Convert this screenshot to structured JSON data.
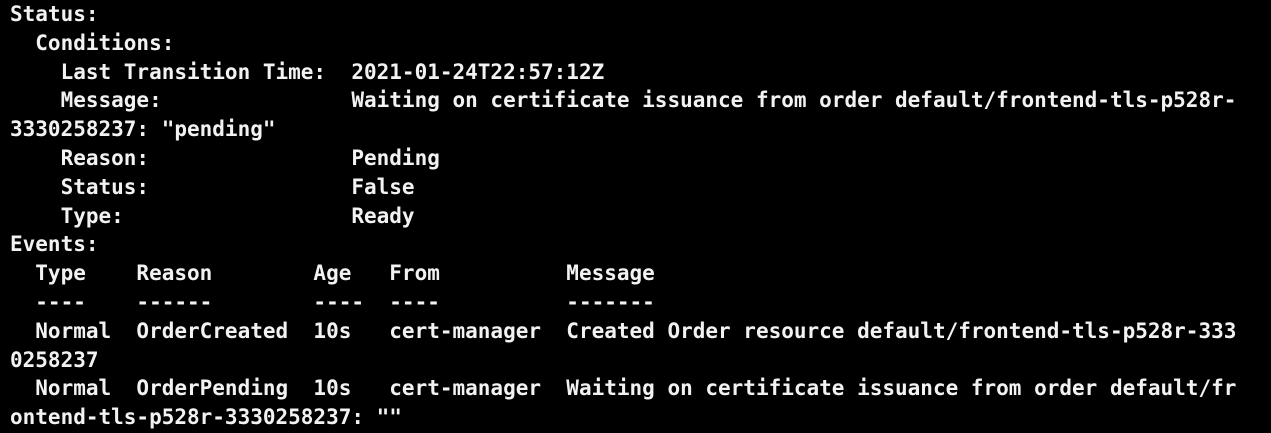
{
  "terminal": {
    "lines": [
      "Status:",
      "  Conditions:",
      "    Last Transition Time:  2021-01-24T22:57:12Z",
      "    Message:               Waiting on certificate issuance from order default/frontend-tls-p528r-",
      "3330258237: \"pending\"",
      "    Reason:                Pending",
      "    Status:                False",
      "    Type:                  Ready",
      "Events:",
      "  Type    Reason        Age   From          Message",
      "  ----    ------        ----  ----          -------",
      "  Normal  OrderCreated  10s   cert-manager  Created Order resource default/frontend-tls-p528r-333",
      "0258237",
      "  Normal  OrderPending  10s   cert-manager  Waiting on certificate issuance from order default/fr",
      "ontend-tls-p528r-3330258237: \"\""
    ]
  },
  "colors": {
    "background": "#000000",
    "foreground": "#f2f2f2"
  }
}
